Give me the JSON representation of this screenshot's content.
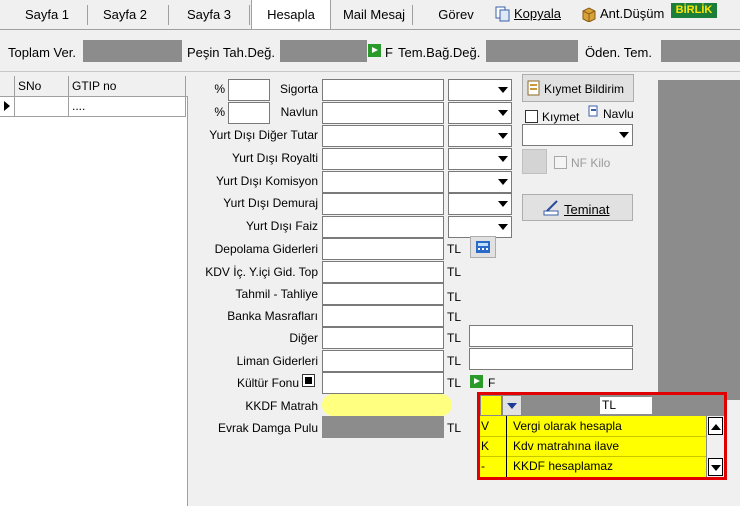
{
  "tabs": [
    {
      "label": "Sayfa 1"
    },
    {
      "label": "Sayfa 2"
    },
    {
      "label": "Sayfa 3"
    },
    {
      "label": "Hesapla"
    },
    {
      "label": "Mail Mesaj"
    },
    {
      "label": "Görev"
    }
  ],
  "toolbar": {
    "copy_label": "Kopyala",
    "warehouse_label": "Ant.Düşüm",
    "birlik_label": "BİRLİK"
  },
  "totals": {
    "total_label": "Toplam Ver.",
    "cash_label": "Peşin Tah.Değ.",
    "cash_flag": "F",
    "guarantee_label": "Tem.Bağ.Değ.",
    "paid_label": "Öden. Tem."
  },
  "grid": {
    "headers": [
      "SNo",
      "GTIP no"
    ],
    "row_value": "...."
  },
  "form": {
    "pct1": "%",
    "pct2": "%",
    "insurance": "Sigorta",
    "freight": "Navlun",
    "other_amount": "Yurt Dışı Diğer Tutar",
    "royalty": "Yurt Dışı Royalti",
    "commission": "Yurt Dışı Komisyon",
    "demurrage": "Yurt Dışı Demuraj",
    "interest": "Yurt Dışı Faiz",
    "storage": "Depolama Giderleri",
    "kdv_domestic": "KDV İç. Y.içi Gid. Top",
    "loading": "Tahmil - Tahliye",
    "bank": "Banka Masrafları",
    "other": "Diğer",
    "port": "Liman Giderleri",
    "culture": "Kültür Fonu",
    "kkdf": "KKDF Matrah",
    "stamp": "Evrak Damga Pulu",
    "tl": "TL",
    "f_flag": "F"
  },
  "right_panel": {
    "value_notice": "Kıymet Bildirim",
    "value_check": "Kıymet",
    "freight_btn": "Navlu",
    "nf_kilo": "NF Kilo",
    "guarantee_btn": "Teminat"
  },
  "kkdf_combo": {
    "currency": "TL",
    "selected": "V"
  },
  "dropdown": {
    "options": [
      {
        "code": "V",
        "text": "Vergi olarak hesapla"
      },
      {
        "code": "K",
        "text": "Kdv matrahına ilave"
      },
      {
        "code": "-",
        "text": "KKDF hesaplamaz"
      }
    ]
  },
  "colors": {
    "highlight": "#ffff00",
    "dropdown_border": "#e00000",
    "field_yellow": "#ffff80"
  }
}
